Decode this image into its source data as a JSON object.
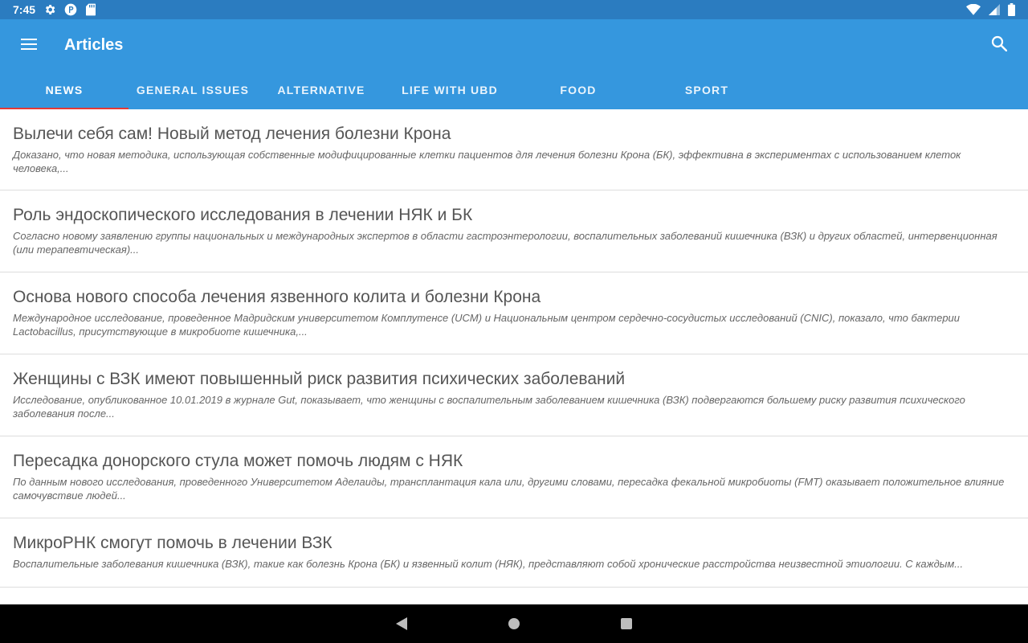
{
  "status_bar": {
    "time": "7:45",
    "left_icons": [
      "gear-icon",
      "parking-icon",
      "sd-card-icon"
    ],
    "right_icons": [
      "wifi-icon",
      "signal-icon",
      "battery-icon"
    ]
  },
  "app_bar": {
    "title": "Articles",
    "menu_icon": "hamburger-menu-icon",
    "search_icon": "search-icon",
    "color": "#3597de",
    "status_color": "#2b7cc0",
    "indicator_color": "#e53935"
  },
  "tabs": [
    {
      "label": "NEWS",
      "selected": true
    },
    {
      "label": "GENERAL ISSUES",
      "selected": false
    },
    {
      "label": "ALTERNATIVE",
      "selected": false
    },
    {
      "label": "LIFE WITH UBD",
      "selected": false
    },
    {
      "label": "FOOD",
      "selected": false
    },
    {
      "label": "SPORT",
      "selected": false
    }
  ],
  "articles": [
    {
      "title": "Вылечи себя сам! Новый метод лечения болезни Крона",
      "summary": "Доказано, что новая методика, использующая собственные модифицированные клетки пациентов для лечения болезни Крона (БК), эффективна в экспериментах с использованием клеток человека,..."
    },
    {
      "title": "Роль эндоскопического исследования в лечении НЯК и БК",
      "summary": "Согласно новому заявлению группы национальных и международных экспертов в области гастроэнтерологии, воспалительных заболеваний кишечника (ВЗК) и других областей, интервенционная (или терапевтическая)..."
    },
    {
      "title": "Основа нового способа лечения язвенного колита и болезни Крона",
      "summary": "Международное исследование, проведенное Мадридским университетом Комплутенсе (UCM) и Национальным центром сердечно-сосудистых исследований (CNIC), показало, что бактерии Lactobacillus, присутствующие в микробиоте кишечника,..."
    },
    {
      "title": "Женщины с ВЗК имеют повышенный риск развития психических заболеваний",
      "summary": "Исследование, опубликованное 10.01.2019 в журнале Gut, показывает, что женщины с воспалительным заболеванием кишечника (ВЗК) подвергаются большему риску развития психического заболевания после..."
    },
    {
      "title": "Пересадка донорского стула может помочь людям с НЯК",
      "summary": "По данным нового исследования, проведенного Университетом Аделаиды, трансплантация кала или, другими словами, пересадка фекальной микробиоты (FMT) оказывает положительное влияние самочувствие людей..."
    },
    {
      "title": "МикроРНК смогут помочь в лечении ВЗК",
      "summary": "Воспалительные заболевания кишечника (ВЗК), такие как болезнь Крона (БК) и язвенный колит (НЯК), представляют собой хронические расстройства неизвестной этиологии. С каждым..."
    }
  ],
  "nav_bar": {
    "back_icon": "back-triangle-icon",
    "home_icon": "home-circle-icon",
    "recents_icon": "recents-square-icon"
  }
}
